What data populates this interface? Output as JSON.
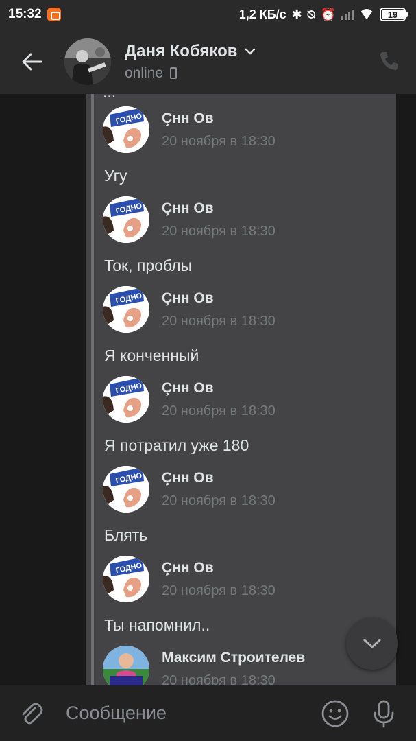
{
  "status_bar": {
    "time": "15:32",
    "network_speed": "1,2 КБ/с",
    "battery_level": "19"
  },
  "header": {
    "contact_name": "Даня Кобяков",
    "contact_status": "online",
    "icons": [
      "back-arrow-icon",
      "chevron-down-icon",
      "mobile-phone-icon",
      "phone-call-icon"
    ]
  },
  "chat": {
    "partial_text_top": "...",
    "messages": [
      {
        "author": "Çнн Ов",
        "date": "20 ноября в 18:30",
        "text": "Угу"
      },
      {
        "author": "Çнн Ов",
        "date": "20 ноября в 18:30",
        "text": "Ток, проблы"
      },
      {
        "author": "Çнн Ов",
        "date": "20 ноября в 18:30",
        "text": "Я конченный"
      },
      {
        "author": "Çнн Ов",
        "date": "20 ноября в 18:30",
        "text": "Я потратил уже 180"
      },
      {
        "author": "Çнн Ов",
        "date": "20 ноября в 18:30",
        "text": "Блять"
      },
      {
        "author": "Çнн Ов",
        "date": "20 ноября в 18:30",
        "text": "Ты напомнил.."
      },
      {
        "author": "Максим Строителев",
        "date": "20 ноября в 18:30",
        "text": ""
      }
    ]
  },
  "composer": {
    "placeholder": "Сообщение",
    "icons": [
      "paperclip-icon",
      "emoji-icon",
      "microphone-icon"
    ]
  },
  "colors": {
    "background": "#19191a",
    "bar": "#2a2a2b",
    "bubble": "#444446",
    "text": "#e1e3e6",
    "secondary_text": "#76787a"
  }
}
